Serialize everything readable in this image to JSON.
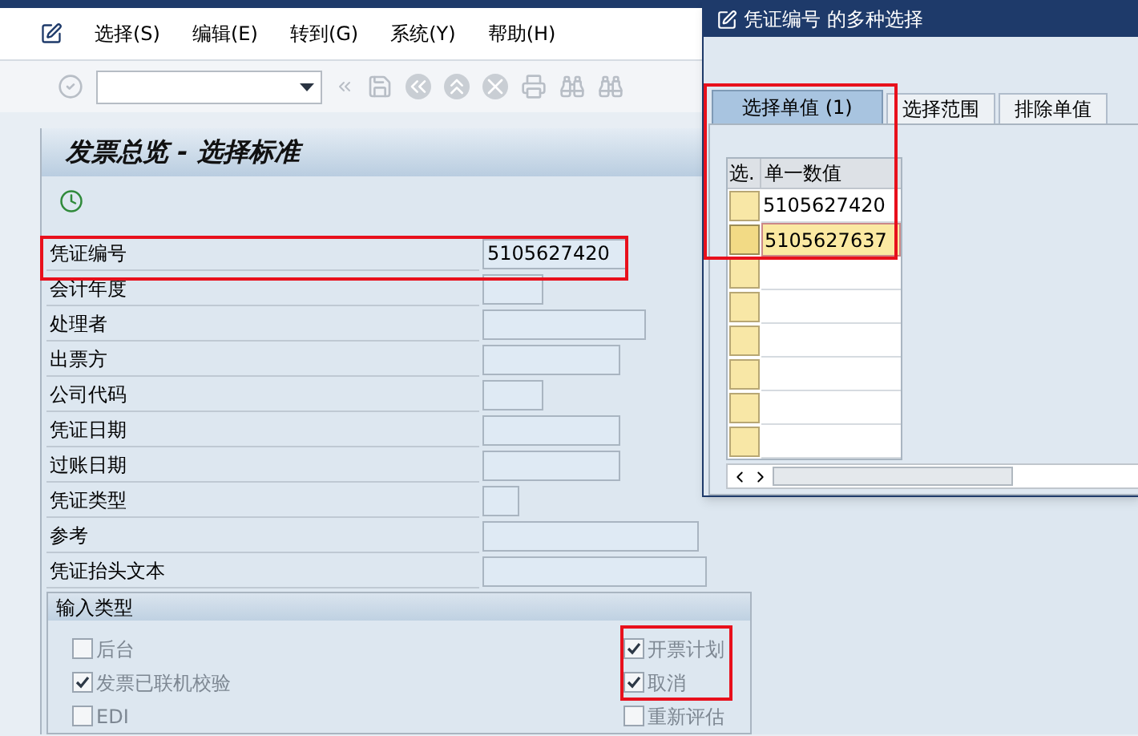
{
  "menu": [
    "选择(S)",
    "编辑(E)",
    "转到(G)",
    "系统(Y)",
    "帮助(H)"
  ],
  "screen_title": "发票总览 - 选择标准",
  "fields": [
    {
      "label": "凭证编号",
      "value": "5105627420"
    },
    {
      "label": "会计年度"
    },
    {
      "label": "处理者"
    },
    {
      "label": "出票方"
    },
    {
      "label": "公司代码"
    },
    {
      "label": "凭证日期"
    },
    {
      "label": "过账日期"
    },
    {
      "label": "凭证类型"
    },
    {
      "label": "参考"
    },
    {
      "label": "凭证抬头文本"
    }
  ],
  "input_type": {
    "title": "输入类型",
    "options": [
      {
        "label": "后台",
        "checked": false
      },
      {
        "label": "开票计划",
        "checked": true
      },
      {
        "label": "发票已联机校验",
        "checked": true
      },
      {
        "label": "取消",
        "checked": true
      },
      {
        "label": "EDI",
        "checked": false
      },
      {
        "label": "重新评估",
        "checked": false
      }
    ]
  },
  "dialog": {
    "title": "凭证编号 的多种选择",
    "tabs": [
      {
        "label": "选择单值 (1)",
        "selected": true
      },
      {
        "label": "选择范围",
        "selected": false
      },
      {
        "label": "排除单值",
        "selected": false
      }
    ],
    "columns": [
      "选.",
      "单一数值"
    ],
    "rows": [
      {
        "value": "5105627420",
        "selected": false
      },
      {
        "value": "5105627637",
        "selected": true
      },
      {
        "selected": false
      },
      {
        "selected": false
      },
      {
        "selected": false
      },
      {
        "selected": false
      },
      {
        "selected": false
      },
      {
        "selected": false
      }
    ]
  }
}
